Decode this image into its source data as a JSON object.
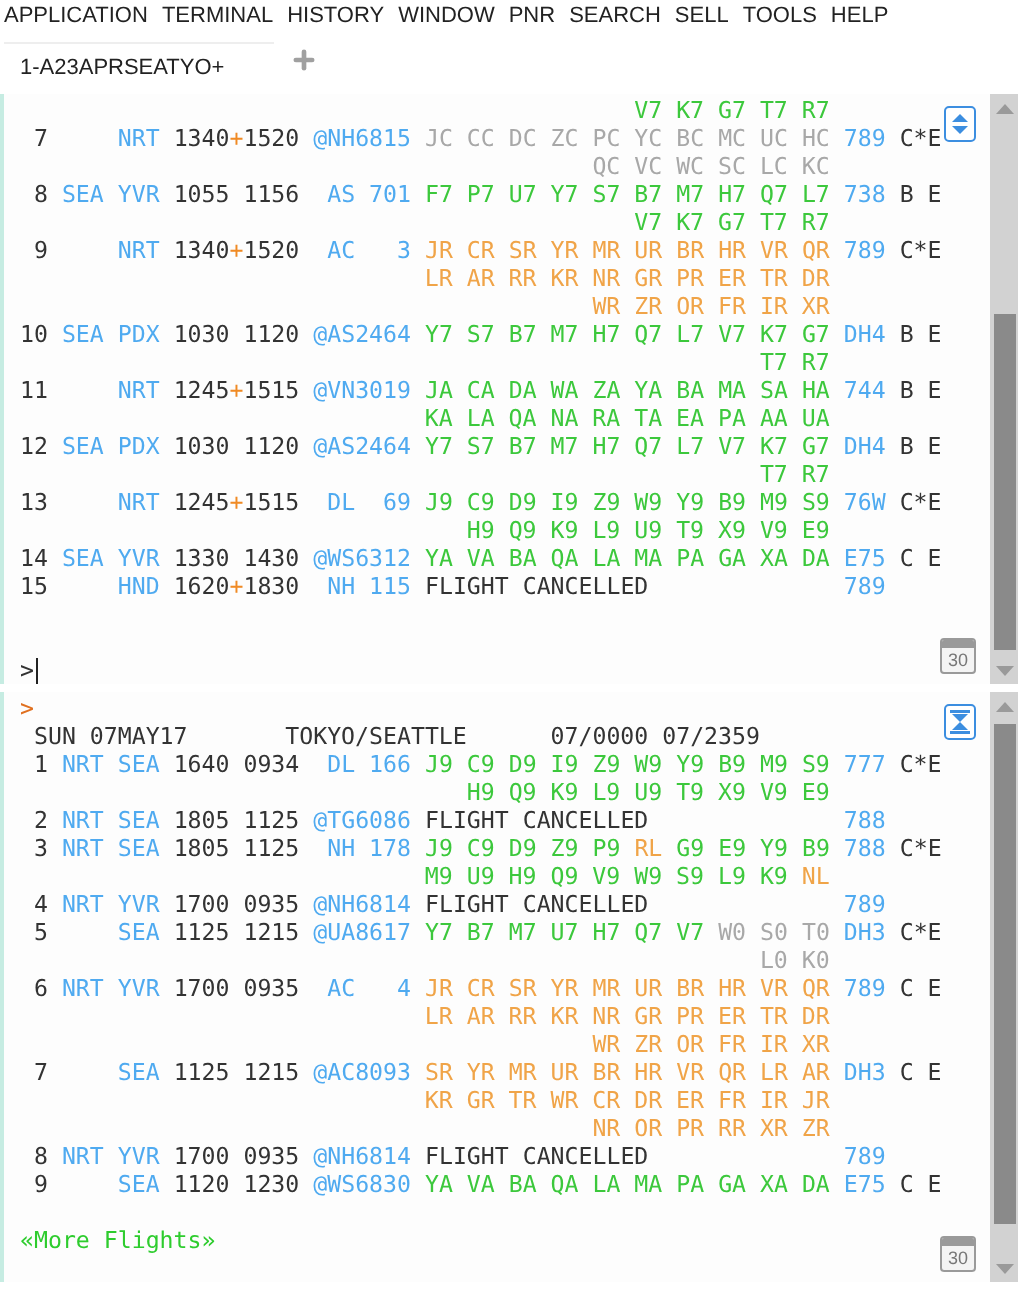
{
  "menu": [
    "APPLICATION",
    "TERMINAL",
    "HISTORY",
    "WINDOW",
    "PNR",
    "SEARCH",
    "SELL",
    "TOOLS",
    "HELP"
  ],
  "tabs": [
    {
      "label": "1-A23APRSEATYO+",
      "selected": true
    }
  ],
  "panes": [
    {
      "maximized": false,
      "calendar_day": "30",
      "lines": [
        [
          {
            "kind": "open",
            "text": "                                            V7 K7 G7 T7 R7"
          }
        ],
        [
          {
            "kind": "plain",
            "text": " 7"
          },
          {
            "kind": "city",
            "text": "     NRT"
          },
          {
            "kind": "plain",
            "text": " 1340"
          },
          {
            "kind": "plus",
            "text": "+"
          },
          {
            "kind": "plain",
            "text": "1520"
          },
          {
            "kind": "flight",
            "text": " @NH6815"
          },
          {
            "kind": "closed",
            "text": " JC CC DC ZC PC YC BC MC UC HC"
          },
          {
            "kind": "equip",
            "text": " 789"
          },
          {
            "kind": "plain",
            "text": " C*E"
          }
        ],
        [
          {
            "kind": "closed",
            "text": "                                         QC VC WC SC LC KC"
          }
        ],
        [
          {
            "kind": "plain",
            "text": " 8"
          },
          {
            "kind": "city",
            "text": " SEA YVR"
          },
          {
            "kind": "plain",
            "text": " 1055 1156"
          },
          {
            "kind": "flight",
            "text": "  AS 701"
          },
          {
            "kind": "open",
            "text": " F7 P7 U7 Y7 S7 B7 M7 H7 Q7 L7"
          },
          {
            "kind": "equip",
            "text": " 738"
          },
          {
            "kind": "plain",
            "text": " B E"
          }
        ],
        [
          {
            "kind": "open",
            "text": "                                            V7 K7 G7 T7 R7"
          }
        ],
        [
          {
            "kind": "plain",
            "text": " 9"
          },
          {
            "kind": "city",
            "text": "     NRT"
          },
          {
            "kind": "plain",
            "text": " 1340"
          },
          {
            "kind": "plus",
            "text": "+"
          },
          {
            "kind": "plain",
            "text": "1520"
          },
          {
            "kind": "flight",
            "text": "  AC   3"
          },
          {
            "kind": "request",
            "text": " JR CR SR YR MR UR BR HR VR QR"
          },
          {
            "kind": "equip",
            "text": " 789"
          },
          {
            "kind": "plain",
            "text": " C*E"
          }
        ],
        [
          {
            "kind": "request",
            "text": "                             LR AR RR KR NR GR PR ER TR DR"
          }
        ],
        [
          {
            "kind": "request",
            "text": "                                         WR ZR OR FR IR XR"
          }
        ],
        [
          {
            "kind": "plain",
            "text": "10"
          },
          {
            "kind": "city",
            "text": " SEA PDX"
          },
          {
            "kind": "plain",
            "text": " 1030 1120"
          },
          {
            "kind": "flight",
            "text": " @AS2464"
          },
          {
            "kind": "open",
            "text": " Y7 S7 B7 M7 H7 Q7 L7 V7 K7 G7"
          },
          {
            "kind": "equip",
            "text": " DH4"
          },
          {
            "kind": "plain",
            "text": " B E"
          }
        ],
        [
          {
            "kind": "open",
            "text": "                                                     T7 R7"
          }
        ],
        [
          {
            "kind": "plain",
            "text": "11"
          },
          {
            "kind": "city",
            "text": "     NRT"
          },
          {
            "kind": "plain",
            "text": " 1245"
          },
          {
            "kind": "plus",
            "text": "+"
          },
          {
            "kind": "plain",
            "text": "1515"
          },
          {
            "kind": "flight",
            "text": " @VN3019"
          },
          {
            "kind": "open",
            "text": " JA CA DA WA ZA YA BA MA SA HA"
          },
          {
            "kind": "equip",
            "text": " 744"
          },
          {
            "kind": "plain",
            "text": " B E"
          }
        ],
        [
          {
            "kind": "open",
            "text": "                             KA LA QA NA RA TA EA PA AA UA"
          }
        ],
        [
          {
            "kind": "plain",
            "text": "12"
          },
          {
            "kind": "city",
            "text": " SEA PDX"
          },
          {
            "kind": "plain",
            "text": " 1030 1120"
          },
          {
            "kind": "flight",
            "text": " @AS2464"
          },
          {
            "kind": "open",
            "text": " Y7 S7 B7 M7 H7 Q7 L7 V7 K7 G7"
          },
          {
            "kind": "equip",
            "text": " DH4"
          },
          {
            "kind": "plain",
            "text": " B E"
          }
        ],
        [
          {
            "kind": "open",
            "text": "                                                     T7 R7"
          }
        ],
        [
          {
            "kind": "plain",
            "text": "13"
          },
          {
            "kind": "city",
            "text": "     NRT"
          },
          {
            "kind": "plain",
            "text": " 1245"
          },
          {
            "kind": "plus",
            "text": "+"
          },
          {
            "kind": "plain",
            "text": "1515"
          },
          {
            "kind": "flight",
            "text": "  DL  69"
          },
          {
            "kind": "open",
            "text": " J9 C9 D9 I9 Z9 W9 Y9 B9 M9 S9"
          },
          {
            "kind": "equip",
            "text": " 76W"
          },
          {
            "kind": "plain",
            "text": " C*E"
          }
        ],
        [
          {
            "kind": "open",
            "text": "                                H9 Q9 K9 L9 U9 T9 X9 V9 E9"
          }
        ],
        [
          {
            "kind": "plain",
            "text": "14"
          },
          {
            "kind": "city",
            "text": " SEA YVR"
          },
          {
            "kind": "plain",
            "text": " 1330 1430"
          },
          {
            "kind": "flight",
            "text": " @WS6312"
          },
          {
            "kind": "open",
            "text": " YA VA BA QA LA MA PA GA XA DA"
          },
          {
            "kind": "equip",
            "text": " E75"
          },
          {
            "kind": "plain",
            "text": " C E"
          }
        ],
        [
          {
            "kind": "plain",
            "text": "15"
          },
          {
            "kind": "city",
            "text": "     HND"
          },
          {
            "kind": "plain",
            "text": " 1620"
          },
          {
            "kind": "plus",
            "text": "+"
          },
          {
            "kind": "plain",
            "text": "1830"
          },
          {
            "kind": "flight",
            "text": "  NH 115"
          },
          {
            "kind": "plain",
            "text": " FLIGHT CANCELLED"
          },
          {
            "kind": "equip",
            "text": "              789"
          }
        ]
      ],
      "prompt": {
        "text": ">",
        "cursor": true
      }
    },
    {
      "maximized": true,
      "calendar_day": "30",
      "lines": [
        [
          {
            "kind": "marker",
            "text": ">"
          }
        ],
        [
          {
            "kind": "plain",
            "text": " SUN 07MAY17"
          },
          {
            "kind": "plain",
            "text": "       TOKYO/SEATTLE"
          },
          {
            "kind": "plain",
            "text": "      07/0000 07/2359"
          }
        ],
        [
          {
            "kind": "plain",
            "text": " 1"
          },
          {
            "kind": "city",
            "text": " NRT SEA"
          },
          {
            "kind": "plain",
            "text": " 1640 0934"
          },
          {
            "kind": "flight",
            "text": "  DL 166"
          },
          {
            "kind": "open",
            "text": " J9 C9 D9 I9 Z9 W9 Y9 B9 M9 S9"
          },
          {
            "kind": "equip",
            "text": " 777"
          },
          {
            "kind": "plain",
            "text": " C*E"
          }
        ],
        [
          {
            "kind": "open",
            "text": "                                H9 Q9 K9 L9 U9 T9 X9 V9 E9"
          }
        ],
        [
          {
            "kind": "plain",
            "text": " 2"
          },
          {
            "kind": "city",
            "text": " NRT SEA"
          },
          {
            "kind": "plain",
            "text": " 1805 1125"
          },
          {
            "kind": "flight",
            "text": " @TG6086"
          },
          {
            "kind": "plain",
            "text": " FLIGHT CANCELLED"
          },
          {
            "kind": "equip",
            "text": "              788"
          }
        ],
        [
          {
            "kind": "plain",
            "text": " 3"
          },
          {
            "kind": "city",
            "text": " NRT SEA"
          },
          {
            "kind": "plain",
            "text": " 1805 1125"
          },
          {
            "kind": "flight",
            "text": "  NH 178"
          },
          {
            "kind": "open",
            "text": " J9 C9 D9 Z9 P9"
          },
          {
            "kind": "request",
            "text": " RL"
          },
          {
            "kind": "open",
            "text": " G9 E9 Y9 B9"
          },
          {
            "kind": "equip",
            "text": " 788"
          },
          {
            "kind": "plain",
            "text": " C*E"
          }
        ],
        [
          {
            "kind": "open",
            "text": "                             M9 U9 H9 Q9 V9 W9 S9 L9 K9"
          },
          {
            "kind": "request",
            "text": " NL"
          }
        ],
        [
          {
            "kind": "plain",
            "text": " 4"
          },
          {
            "kind": "city",
            "text": " NRT YVR"
          },
          {
            "kind": "plain",
            "text": " 1700 0935"
          },
          {
            "kind": "flight",
            "text": " @NH6814"
          },
          {
            "kind": "plain",
            "text": " FLIGHT CANCELLED"
          },
          {
            "kind": "equip",
            "text": "              789"
          }
        ],
        [
          {
            "kind": "plain",
            "text": " 5"
          },
          {
            "kind": "city",
            "text": "     SEA"
          },
          {
            "kind": "plain",
            "text": " 1125 1215"
          },
          {
            "kind": "flight",
            "text": " @UA8617"
          },
          {
            "kind": "open",
            "text": " Y7 B7 M7 U7 H7 Q7 V7"
          },
          {
            "kind": "closed",
            "text": " W0 S0 T0"
          },
          {
            "kind": "equip",
            "text": " DH3"
          },
          {
            "kind": "plain",
            "text": " C*E"
          }
        ],
        [
          {
            "kind": "closed",
            "text": "                                                     L0 K0"
          }
        ],
        [
          {
            "kind": "plain",
            "text": " 6"
          },
          {
            "kind": "city",
            "text": " NRT YVR"
          },
          {
            "kind": "plain",
            "text": " 1700 0935"
          },
          {
            "kind": "flight",
            "text": "  AC   4"
          },
          {
            "kind": "request",
            "text": " JR CR SR YR MR UR BR HR VR QR"
          },
          {
            "kind": "equip",
            "text": " 789"
          },
          {
            "kind": "plain",
            "text": " C E"
          }
        ],
        [
          {
            "kind": "request",
            "text": "                             LR AR RR KR NR GR PR ER TR DR"
          }
        ],
        [
          {
            "kind": "request",
            "text": "                                         WR ZR OR FR IR XR"
          }
        ],
        [
          {
            "kind": "plain",
            "text": " 7"
          },
          {
            "kind": "city",
            "text": "     SEA"
          },
          {
            "kind": "plain",
            "text": " 1125 1215"
          },
          {
            "kind": "flight",
            "text": " @AC8093"
          },
          {
            "kind": "request",
            "text": " SR YR MR UR BR HR VR QR LR AR"
          },
          {
            "kind": "equip",
            "text": " DH3"
          },
          {
            "kind": "plain",
            "text": " C E"
          }
        ],
        [
          {
            "kind": "request",
            "text": "                             KR GR TR WR CR DR ER FR IR JR"
          }
        ],
        [
          {
            "kind": "request",
            "text": "                                         NR OR PR RR XR ZR"
          }
        ],
        [
          {
            "kind": "plain",
            "text": " 8"
          },
          {
            "kind": "city",
            "text": " NRT YVR"
          },
          {
            "kind": "plain",
            "text": " 1700 0935"
          },
          {
            "kind": "flight",
            "text": " @NH6814"
          },
          {
            "kind": "plain",
            "text": " FLIGHT CANCELLED"
          },
          {
            "kind": "equip",
            "text": "              789"
          }
        ],
        [
          {
            "kind": "plain",
            "text": " 9"
          },
          {
            "kind": "city",
            "text": "     SEA"
          },
          {
            "kind": "plain",
            "text": " 1120 1230"
          },
          {
            "kind": "flight",
            "text": " @WS6830"
          },
          {
            "kind": "open",
            "text": " YA VA BA QA LA MA PA GA XA DA"
          },
          {
            "kind": "equip",
            "text": " E75"
          },
          {
            "kind": "plain",
            "text": " C E"
          }
        ]
      ],
      "more_link": "«More Flights»"
    }
  ]
}
